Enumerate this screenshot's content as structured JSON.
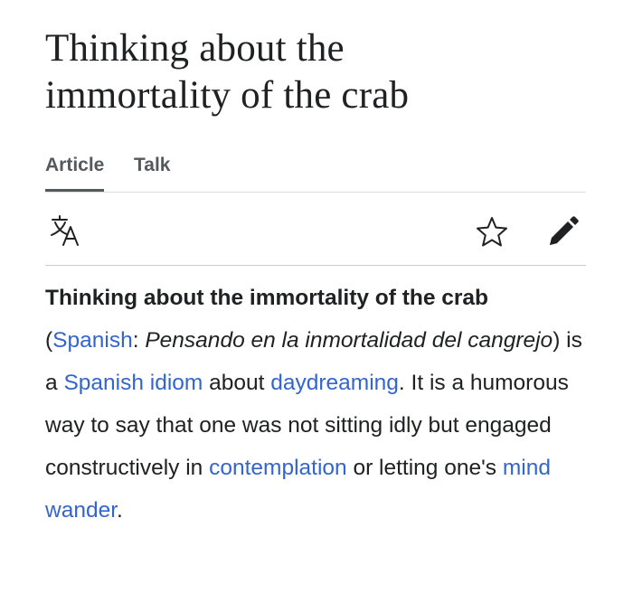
{
  "article": {
    "title_line1": "Thinking about the",
    "title_line2": "immortality of the crab"
  },
  "tabs": [
    {
      "label": "Article",
      "active": true
    },
    {
      "label": "Talk",
      "active": false
    }
  ],
  "toolbar": {
    "language_icon": "translate-icon",
    "watch_icon": "star-icon",
    "edit_icon": "pencil-icon"
  },
  "body": {
    "bold_title": "Thinking about the immortality of the crab",
    "t1": " (",
    "link_spanish": "Spanish",
    "t2": ": ",
    "italic_spanish": "Pensando en la inmortalidad del cangrejo",
    "t3": ") is a ",
    "link_idiom": "Spanish idiom",
    "t4": " about ",
    "link_daydreaming": "daydreaming",
    "t5": ". It is a humorous way to say that one was not sitting idly but engaged constructively in ",
    "link_contemplation": "contemplation",
    "t6": " or letting one's ",
    "link_mind_wander": "mind wander",
    "t7": "."
  },
  "colors": {
    "link": "#3366cc",
    "text": "#202122",
    "icon": "#202122",
    "divider": "#c8ccd1"
  }
}
